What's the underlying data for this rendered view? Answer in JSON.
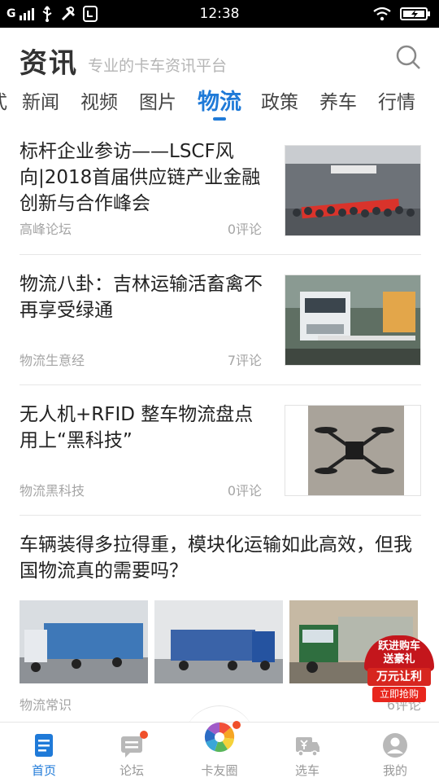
{
  "status_bar": {
    "carrier": "G",
    "time": "12:38"
  },
  "header": {
    "brand": "资讯",
    "slogan": "专业的卡车资讯平台"
  },
  "tabs": [
    {
      "label": "式",
      "active": false
    },
    {
      "label": "新闻",
      "active": false
    },
    {
      "label": "视频",
      "active": false
    },
    {
      "label": "图片",
      "active": false
    },
    {
      "label": "物流",
      "active": true
    },
    {
      "label": "政策",
      "active": false
    },
    {
      "label": "养车",
      "active": false
    },
    {
      "label": "行情",
      "active": false
    }
  ],
  "feed": {
    "items": [
      {
        "title": "标杆企业参访——LSCF风向|2018首届供应链产业金融创新与合作峰会",
        "source": "高峰论坛",
        "comments": "0评论"
      },
      {
        "title": "物流八卦：吉林运输活畜禽不再享受绿通",
        "source": "物流生意经",
        "comments": "7评论"
      },
      {
        "title": "无人机+RFID 整车物流盘点用上“黑科技”",
        "source": "物流黑科技",
        "comments": "0评论"
      },
      {
        "title": "车辆装得多拉得重，模块化运输如此高效，但我国物流真的需要吗？",
        "source": "物流常识",
        "comments": "6评论"
      }
    ]
  },
  "promo": {
    "line1": "跃进购车",
    "line2": "送豪礼",
    "line3": "万元让利",
    "button": "立即抢购"
  },
  "bottom_nav": [
    {
      "label": "首页",
      "icon": "news-doc-icon",
      "active": true
    },
    {
      "label": "论坛",
      "icon": "forum-chat-icon",
      "active": false
    },
    {
      "label": "卡友圈",
      "icon": "pinwheel-icon",
      "active": false
    },
    {
      "label": "选车",
      "icon": "truck-price-icon",
      "active": false
    },
    {
      "label": "我的",
      "icon": "user-profile-icon",
      "active": false
    }
  ],
  "colors": {
    "accent": "#1f7ad8",
    "promo_red": "#c4161c",
    "badge_dot": "#f0502a"
  }
}
